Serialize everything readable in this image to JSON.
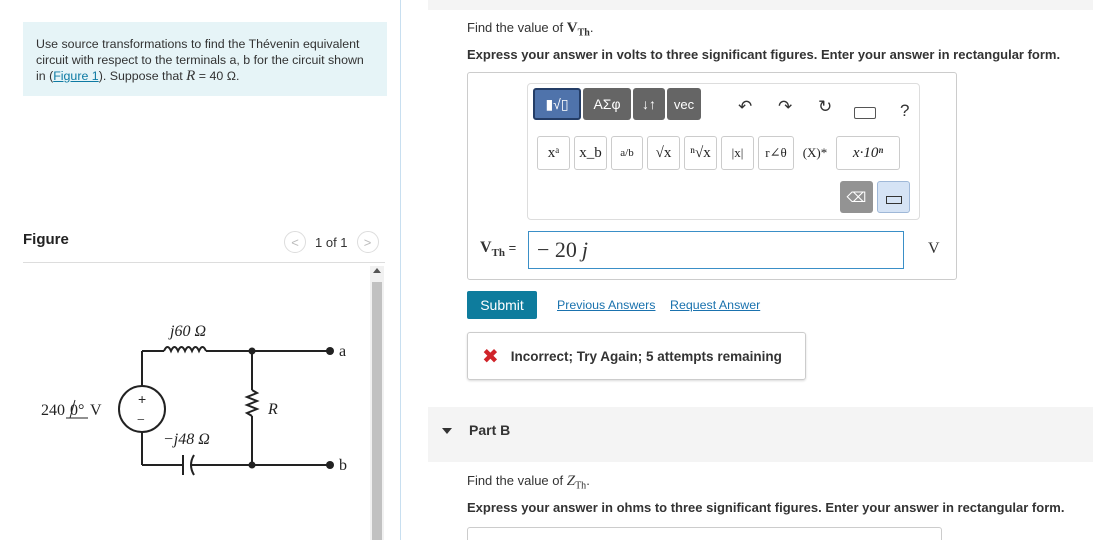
{
  "problem": {
    "text_before_link": "Use source transformations to find the Thévenin equivalent circuit with respect to the terminals a, b for the circuit shown in (",
    "link": "Figure 1",
    "text_after_link": "). Suppose that ",
    "r_symbol": "R",
    "r_value": " = 40 Ω."
  },
  "figure": {
    "title": "Figure",
    "pager": "1 of 1",
    "prev": "<",
    "next": ">",
    "circuit": {
      "source_label": "240",
      "source_angle": "0°",
      "source_unit": " V",
      "inductor_label": "j60 Ω",
      "capacitor_label": "−j48 Ω",
      "resistor_label": "R",
      "terminal_a": "a",
      "terminal_b": "b",
      "plus": "+",
      "minus": "−"
    }
  },
  "part_a": {
    "question_prefix": "Find the value of ",
    "question_var": "V",
    "question_sub": "Th",
    "question_suffix": ".",
    "instruction": "Express your answer in volts to three significant figures. Enter your answer in rectangular form.",
    "toolbar": {
      "templates": "▮√▯",
      "greek": "ΑΣφ",
      "arrows": "↓↑",
      "vec": "vec",
      "undo": "↶",
      "redo": "↷",
      "reset": "↻",
      "help": "?"
    },
    "math_buttons": [
      "xᵃ",
      "x_b",
      "a/b",
      "√x",
      "ⁿ√x",
      "|x|",
      "r∠θ",
      "(X)*",
      "x·10ⁿ"
    ],
    "answer_label_var": "V",
    "answer_label_sub": "Th",
    "answer_label_eq": " =",
    "answer_value": "− 20",
    "answer_imag": "j",
    "unit": "V",
    "submit": "Submit",
    "previous_answers": "Previous Answers",
    "request_answer": "Request Answer",
    "feedback_icon": "✖",
    "feedback": "Incorrect; Try Again; 5 attempts remaining"
  },
  "part_b": {
    "label": "Part B",
    "question_prefix": "Find the value of ",
    "question_var": "Z",
    "question_sub": "Th",
    "question_suffix": ".",
    "instruction": "Express your answer in ohms to three significant figures. Enter your answer in rectangular form."
  },
  "colors": {
    "intro_bg": "#e6f4f7",
    "submit_bg": "#0e7c9d",
    "link": "#1a72ae",
    "error": "#d0242a"
  }
}
